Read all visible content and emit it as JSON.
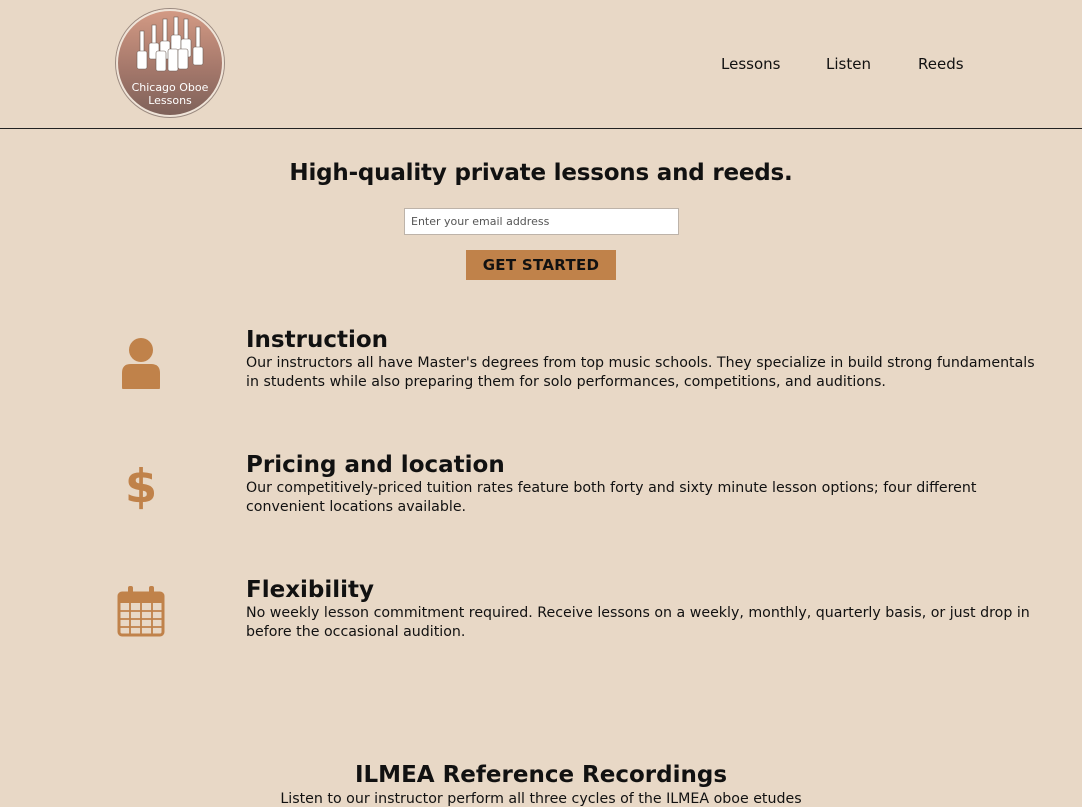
{
  "header": {
    "logo": {
      "line1": "Chicago Oboe",
      "line2": "Lessons"
    },
    "nav": {
      "lessons": "Lessons",
      "listen": "Listen",
      "reeds": "Reeds"
    }
  },
  "hero": {
    "title": "High-quality private lessons and reeds.",
    "email_placeholder": "Enter your email address",
    "email_value": "",
    "cta_label": "GET STARTED"
  },
  "features": [
    {
      "icon": "user-icon",
      "title": "Instruction",
      "description": "Our instructors all have Master's degrees from top music schools. They specialize in build strong fundamentals in students while also preparing them for solo performances, competitions, and auditions."
    },
    {
      "icon": "dollar-icon",
      "title": "Pricing and location",
      "description": "Our competitively-priced tuition rates feature both forty and sixty minute lesson options; four different convenient locations available."
    },
    {
      "icon": "calendar-icon",
      "title": "Flexibility",
      "description": "No weekly lesson commitment required. Receive lessons on a weekly, monthly, quarterly basis, or just drop in before the occasional audition."
    }
  ],
  "recordings": {
    "title": "ILMEA Reference Recordings",
    "description": "Listen to our instructor perform all three cycles of the ILMEA oboe etudes"
  },
  "colors": {
    "background": "#e8d8c6",
    "accent": "#c0824a",
    "text": "#111111"
  }
}
